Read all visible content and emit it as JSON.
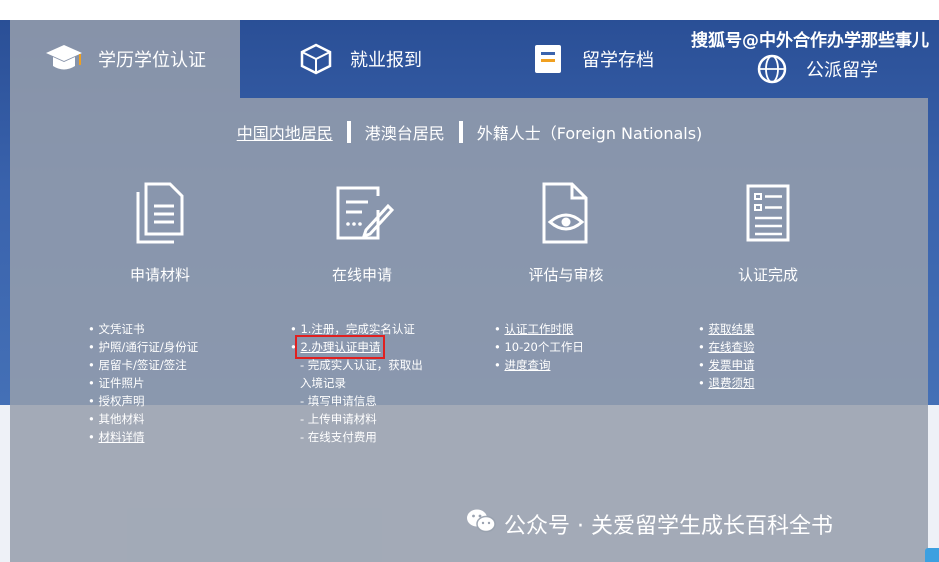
{
  "tabs": [
    {
      "label": "学历学位认证",
      "icon": "graduation-cap-icon"
    },
    {
      "label": "就业报到",
      "icon": "box-icon"
    },
    {
      "label": "留学存档",
      "icon": "archive-icon"
    },
    {
      "label": "公派留学",
      "icon": "globe-icon"
    }
  ],
  "watermark_top": "搜狐号@中外合作办学那些事儿",
  "residency": {
    "mainland": "中国内地居民",
    "hk_macao_tw": "港澳台居民",
    "foreign": "外籍人士（Foreign Nationals)"
  },
  "steps": [
    {
      "label": "申请材料",
      "icon": "documents-icon"
    },
    {
      "label": "在线申请",
      "icon": "edit-form-icon"
    },
    {
      "label": "评估与审核",
      "icon": "review-eye-icon"
    },
    {
      "label": "认证完成",
      "icon": "checklist-icon"
    }
  ],
  "materials": [
    "文凭证书",
    "护照/通行证/身份证",
    "居留卡/签证/签注",
    "证件照片",
    "授权声明",
    "其他材料",
    "材料详情"
  ],
  "online": {
    "step1": "1.注册，完成实名认证",
    "step2": "2.办理认证申请",
    "sub1a": "- 完成实人认证，获取出",
    "sub1b": "入境记录",
    "sub2": "- 填写申请信息",
    "sub3": "- 上传申请材料",
    "sub4": "- 在线支付费用"
  },
  "review": [
    "认证工作时限",
    "10-20个工作日",
    "进度查询"
  ],
  "complete": [
    "获取结果",
    "在线查验",
    "发票申请",
    "退费须知"
  ],
  "wechat_watermark": "公众号 · 关爱留学生成长百科全书"
}
